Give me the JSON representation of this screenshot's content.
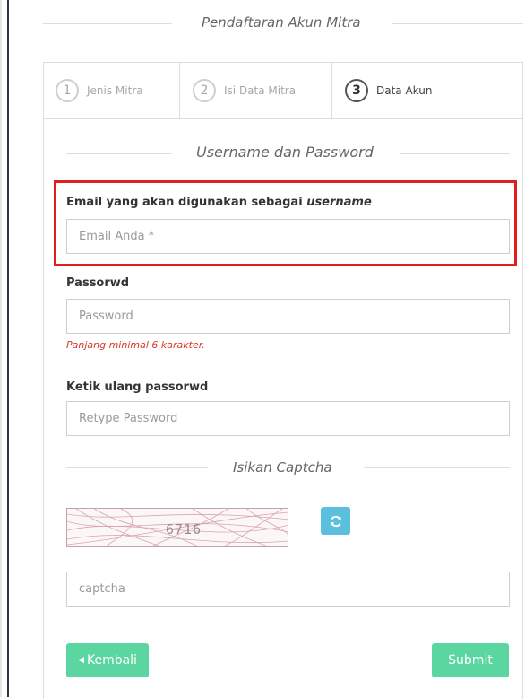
{
  "page_title": "Pendaftaran Akun Mitra",
  "steps": [
    {
      "number": "1",
      "label": "Jenis Mitra",
      "active": false
    },
    {
      "number": "2",
      "label": "Isi Data Mitra",
      "active": false
    },
    {
      "number": "3",
      "label": "Data Akun",
      "active": true
    }
  ],
  "section_title": "Username dan Password",
  "email": {
    "label_prefix": "Email yang akan digunakan sebagai ",
    "label_emphasis": "username",
    "placeholder": "Email Anda *"
  },
  "password": {
    "label": "Passorwd",
    "placeholder": "Password",
    "hint": "Panjang minimal 6 karakter."
  },
  "retype": {
    "label": "Ketik ulang passorwd",
    "placeholder": "Retype Password"
  },
  "captcha_section_title": "Isikan Captcha",
  "captcha": {
    "code": "6716",
    "placeholder": "captcha",
    "refresh_icon": "refresh-icon"
  },
  "buttons": {
    "back_icon": "caret-left-icon",
    "back_label": "Kembali",
    "submit_label": "Submit"
  },
  "colors": {
    "highlight": "#e02020",
    "success": "#5cd6a0",
    "info": "#5bc0de",
    "error_text": "#d9362b"
  }
}
